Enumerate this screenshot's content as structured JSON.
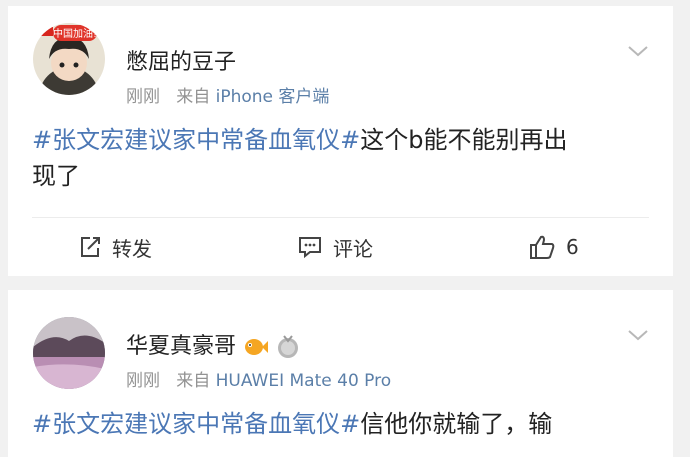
{
  "posts": [
    {
      "username": "憋屈的豆子",
      "avatar_badge": "中国加油!",
      "time": "刚刚",
      "source_prefix": "来自",
      "client": "iPhone 客户端",
      "hashtag": "#张文宏建议家中常备血氧仪#",
      "body_line1": "这个b能不能别再出",
      "body_line2": "现了",
      "actions": {
        "repost_label": "转发",
        "comment_label": "评论",
        "like_count": "6"
      }
    },
    {
      "username": "华夏真豪哥",
      "time": "刚刚",
      "source_prefix": "来自",
      "client": "HUAWEI Mate 40 Pro",
      "hashtag": "#张文宏建议家中常备血氧仪#",
      "body_line1": "信他你就输了，输"
    }
  ],
  "colors": {
    "hashtag": "#4b77b5",
    "meta": "#939393",
    "background": "#f1f1f1"
  },
  "icons": [
    "chevron-down-icon",
    "repost-icon",
    "comment-icon",
    "like-icon",
    "fish-badge-icon",
    "medal-badge-icon"
  ]
}
